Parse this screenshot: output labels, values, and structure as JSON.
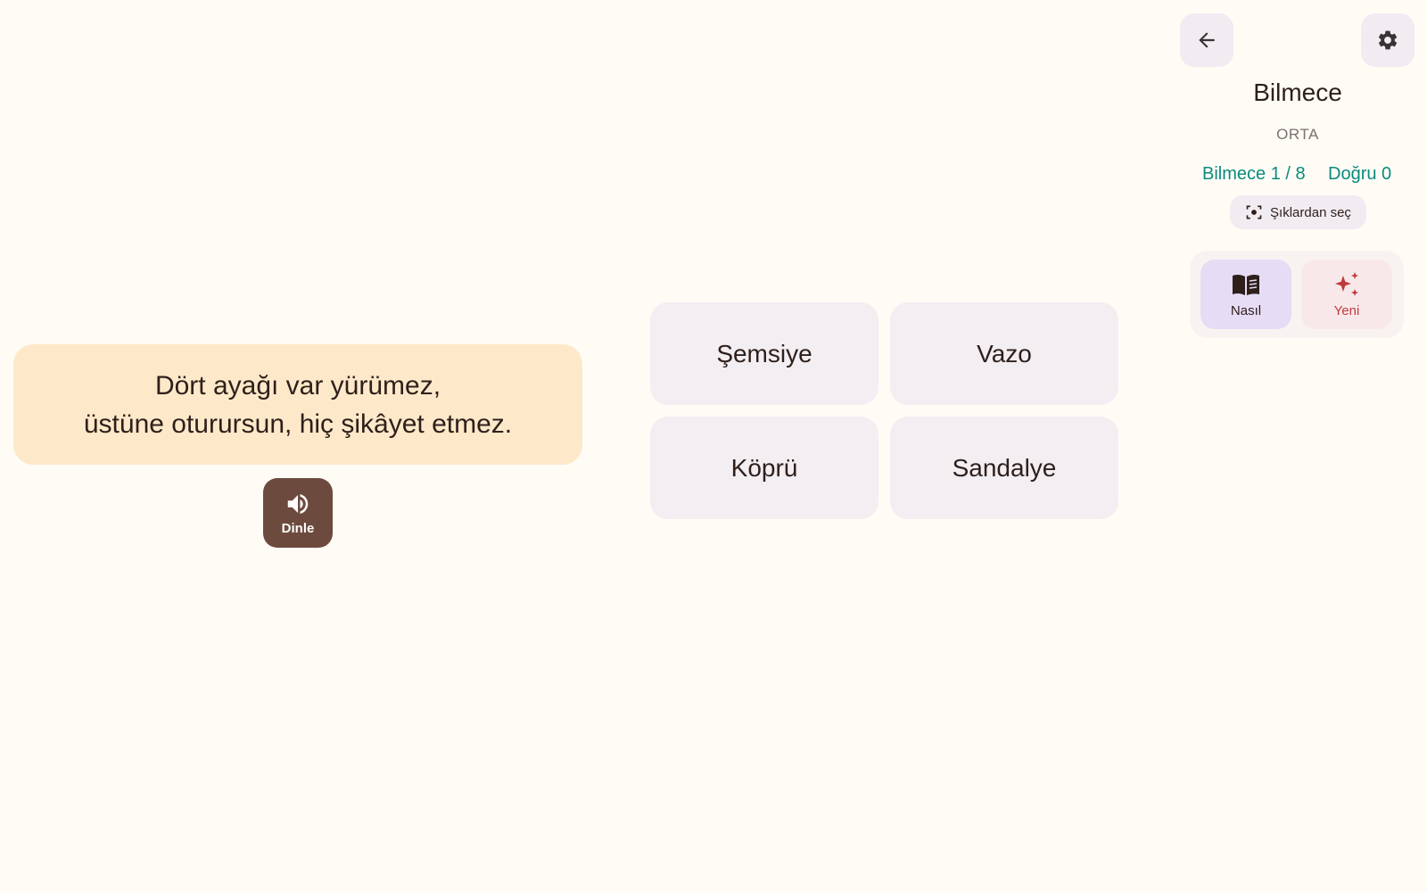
{
  "riddle": {
    "lines": [
      "Dört ayağı var yürümez,",
      "üstüne oturursun, hiç şikâyet etmez."
    ],
    "listen_label": "Dinle"
  },
  "options": [
    "Şemsiye",
    "Vazo",
    "Köprü",
    "Sandalye"
  ],
  "panel": {
    "title": "Bilmece",
    "level": "ORTA",
    "progress": "Bilmece 1 / 8",
    "correct": "Doğru 0",
    "mode_label": "Şıklardan seç",
    "howto_label": "Nasıl",
    "new_label": "Yeni"
  },
  "icons": {
    "back": "arrow-left-icon",
    "settings": "gear-icon",
    "listen": "speaker-icon",
    "mode": "focus-target-icon",
    "howto": "open-book-icon",
    "new": "sparkles-icon"
  },
  "colors": {
    "background": "#fffcf6",
    "riddle_card": "#fde9c9",
    "listen_button": "#6d4a3e",
    "option_bg": "#f2eef2",
    "accent_teal": "#0b8a7d",
    "howto_bg": "#e6dcf5",
    "new_bg": "#f9e8ea",
    "new_fg": "#c0393c"
  }
}
